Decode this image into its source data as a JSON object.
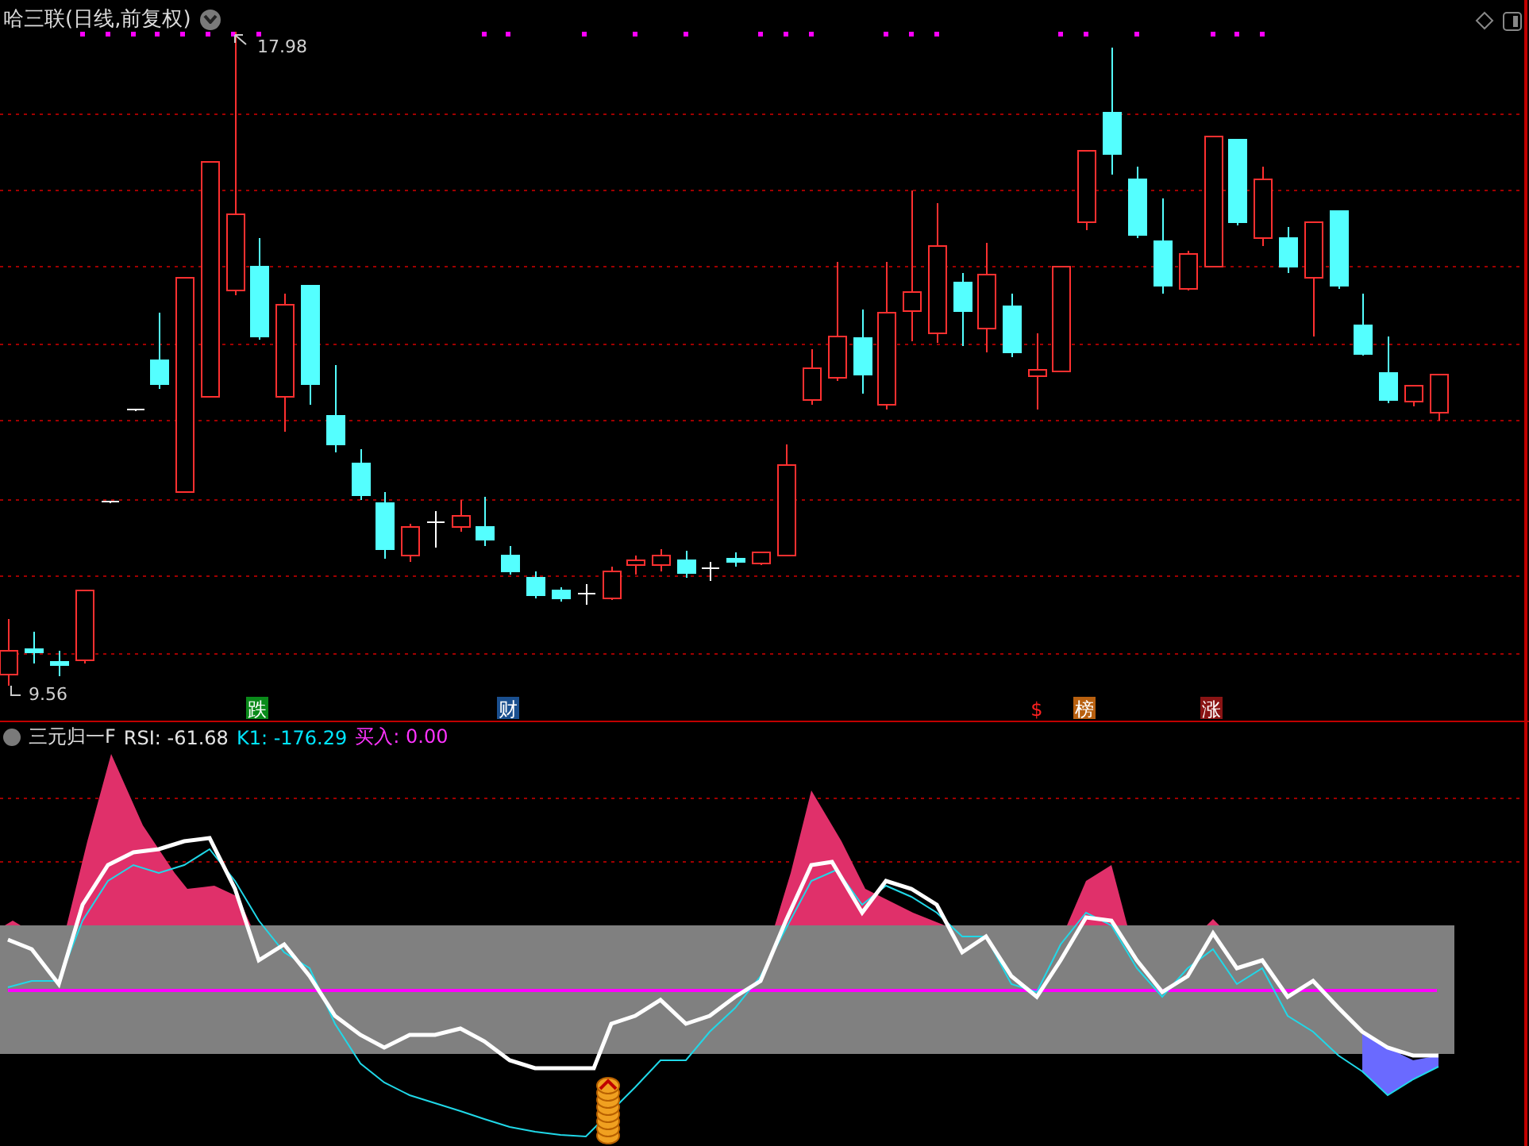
{
  "title": "哈三联(日线,前复权)",
  "price_marks": [
    {
      "kind": "high",
      "text": "17.98"
    },
    {
      "kind": "low",
      "text": "9.56"
    }
  ],
  "event_tags": [
    {
      "text": "跌",
      "kind": "badge",
      "color": "#0a8a1a"
    },
    {
      "text": "财",
      "kind": "badge",
      "color": "#1a4f8f"
    },
    {
      "text": "$",
      "kind": "plain",
      "color": "#ff2020"
    },
    {
      "text": "榜",
      "kind": "badge",
      "color": "#b8600f"
    },
    {
      "text": "涨",
      "kind": "badge",
      "color": "#8a1414"
    }
  ],
  "indicator": {
    "name": "三元归一F",
    "readings": [
      {
        "label": "RSI:",
        "value": "-61.68",
        "color": "#e6e6e6"
      },
      {
        "label": "K1:",
        "value": "-176.29",
        "color": "#00e5ff"
      },
      {
        "label": "买入:",
        "value": "0.00",
        "color": "#ff33ff"
      }
    ]
  }
}
